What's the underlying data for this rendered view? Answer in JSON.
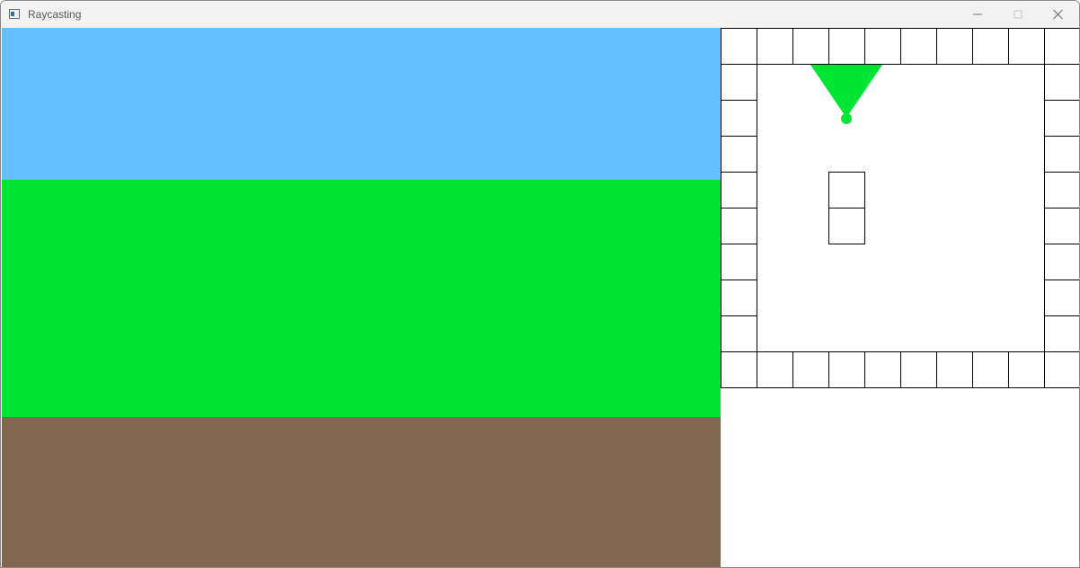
{
  "window": {
    "title": "Raycasting",
    "icon": "app-window-icon",
    "controls": [
      "minimize-icon",
      "maximize-icon",
      "close-icon"
    ]
  },
  "view": {
    "sky_color": "#66bfff",
    "wall_color": "#00e533",
    "floor_color": "#7f684f"
  },
  "minimap": {
    "map": [
      "1111111111",
      "1000000001",
      "1000000001",
      "1000000001",
      "1001000001",
      "1001000001",
      "1000000001",
      "1000000001",
      "1000000001",
      "1111111111"
    ],
    "wall_fill": "#ffffff",
    "grid_line_color": "#000000",
    "player_color": "#00e533",
    "player_cell": [
      3.5,
      2.5
    ],
    "player_facing": "up"
  }
}
